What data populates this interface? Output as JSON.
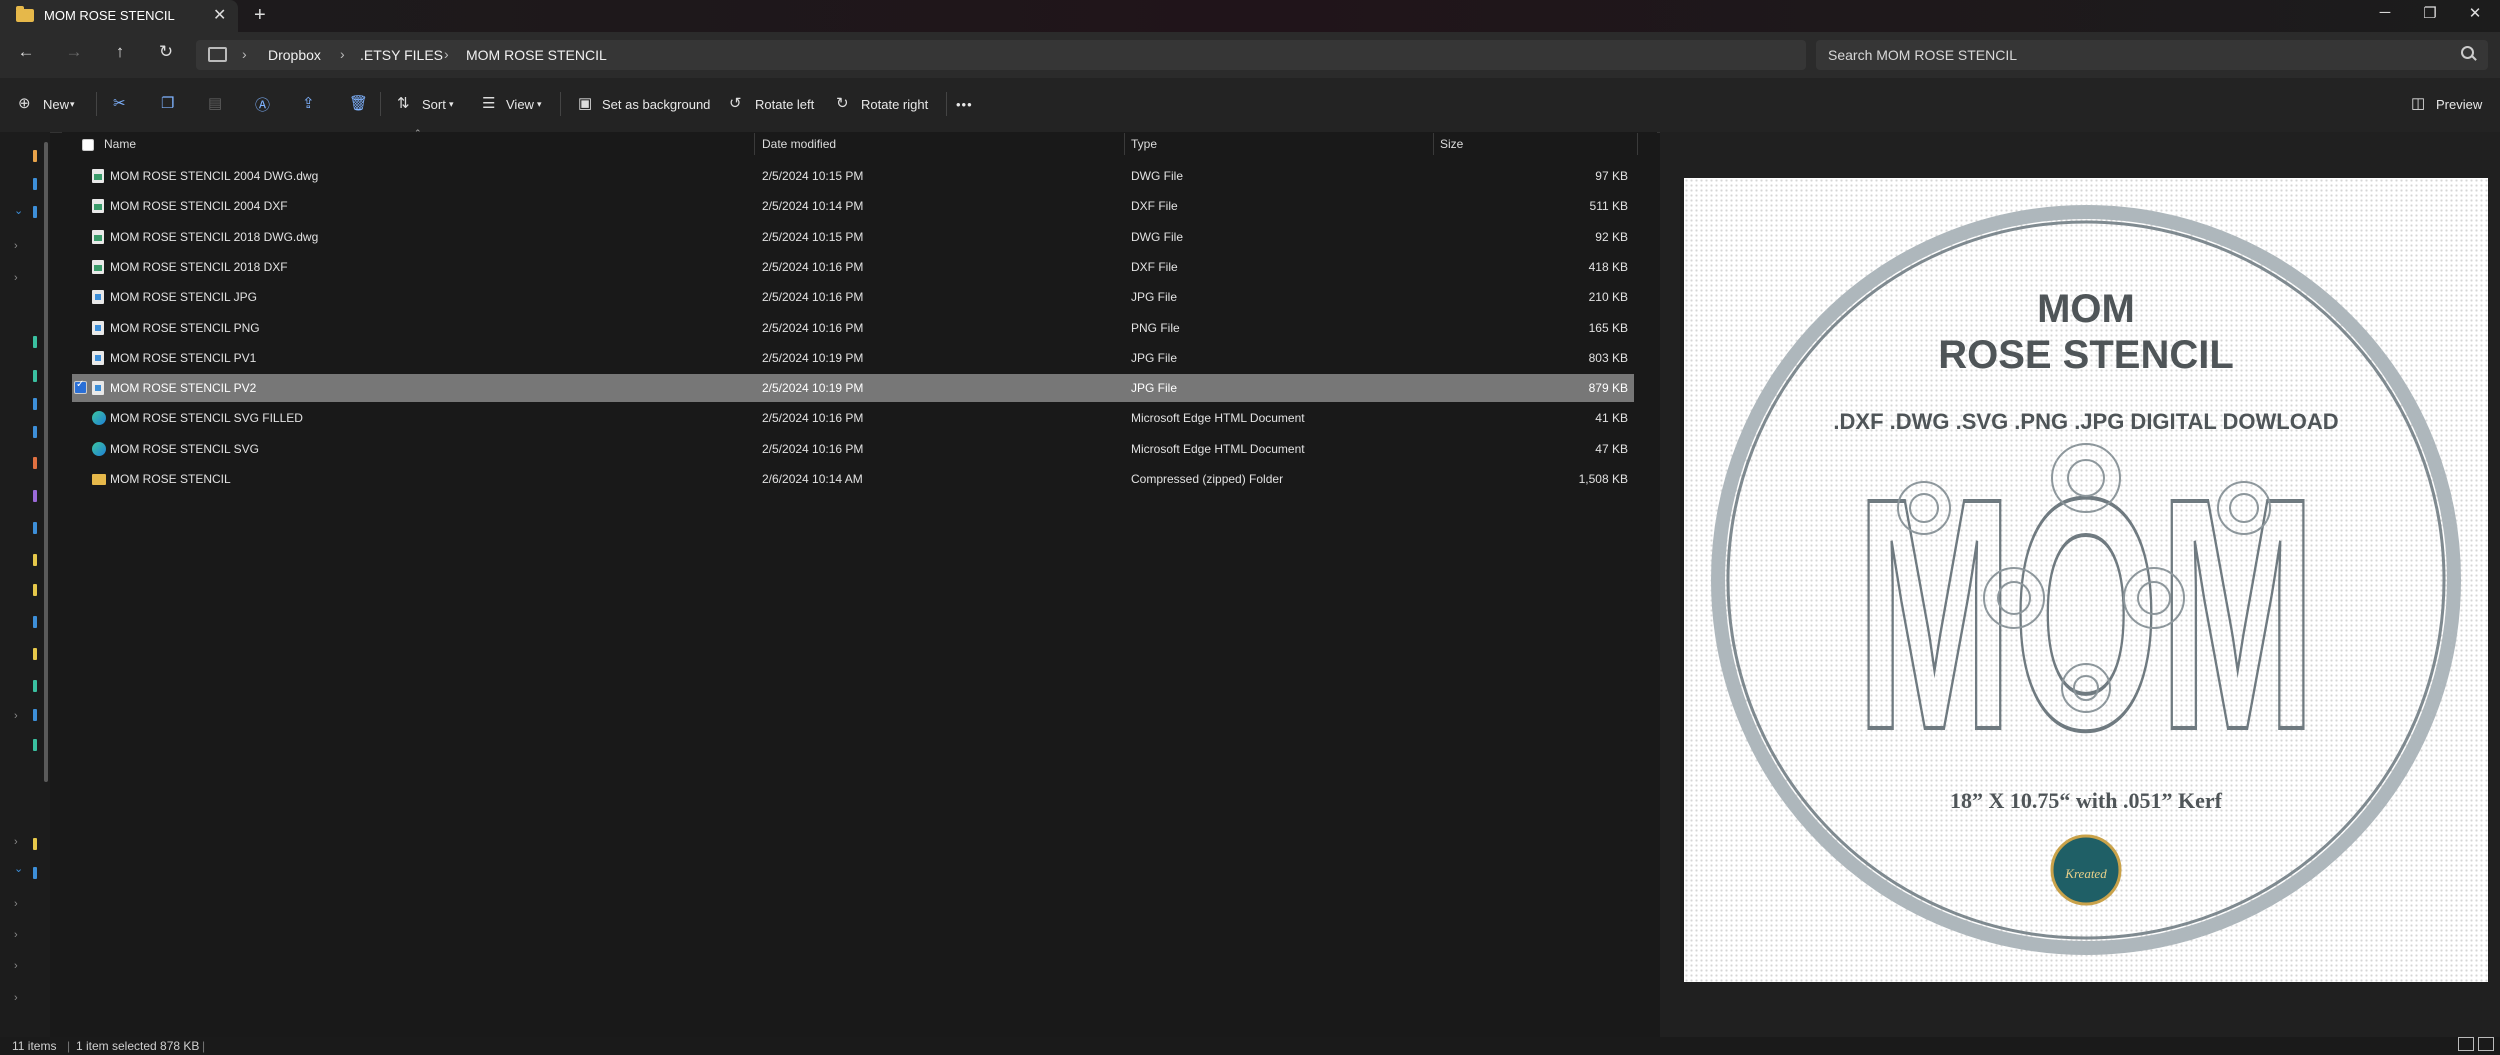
{
  "window": {
    "tab_title": "MOM ROSE STENCIL",
    "new_tab": "+",
    "controls": {
      "minimize": "─",
      "maximize": "❐",
      "close": "✕"
    }
  },
  "address": {
    "breadcrumbs": [
      "Dropbox",
      ".ETSY FILES",
      "MOM ROSE STENCIL"
    ],
    "search_placeholder": "Search MOM ROSE STENCIL"
  },
  "toolbar": {
    "new_label": "New",
    "sort_label": "Sort",
    "view_label": "View",
    "set_background_label": "Set as background",
    "rotate_left_label": "Rotate left",
    "rotate_right_label": "Rotate right",
    "more_label": "•••",
    "preview_label": "Preview"
  },
  "columns": {
    "name": "Name",
    "date": "Date modified",
    "type": "Type",
    "size": "Size"
  },
  "files": [
    {
      "name": "MOM ROSE STENCIL 2004 DWG.dwg",
      "date": "2/5/2024 10:15 PM",
      "type": "DWG File",
      "size": "97 KB",
      "icon": "cad-file-icon",
      "selected": false
    },
    {
      "name": "MOM ROSE STENCIL 2004 DXF",
      "date": "2/5/2024 10:14 PM",
      "type": "DXF File",
      "size": "511 KB",
      "icon": "cad-file-icon",
      "selected": false
    },
    {
      "name": "MOM ROSE STENCIL 2018 DWG.dwg",
      "date": "2/5/2024 10:15 PM",
      "type": "DWG File",
      "size": "92 KB",
      "icon": "cad-file-icon",
      "selected": false
    },
    {
      "name": "MOM ROSE STENCIL 2018 DXF",
      "date": "2/5/2024 10:16 PM",
      "type": "DXF File",
      "size": "418 KB",
      "icon": "cad-file-icon",
      "selected": false
    },
    {
      "name": "MOM ROSE STENCIL JPG",
      "date": "2/5/2024 10:16 PM",
      "type": "JPG File",
      "size": "210 KB",
      "icon": "image-file-icon",
      "selected": false
    },
    {
      "name": "MOM ROSE STENCIL PNG",
      "date": "2/5/2024 10:16 PM",
      "type": "PNG File",
      "size": "165 KB",
      "icon": "image-file-icon",
      "selected": false
    },
    {
      "name": "MOM ROSE STENCIL PV1",
      "date": "2/5/2024 10:19 PM",
      "type": "JPG File",
      "size": "803 KB",
      "icon": "image-file-icon",
      "selected": false
    },
    {
      "name": "MOM ROSE STENCIL PV2",
      "date": "2/5/2024 10:19 PM",
      "type": "JPG File",
      "size": "879 KB",
      "icon": "image-file-icon",
      "selected": true
    },
    {
      "name": "MOM ROSE STENCIL SVG FILLED",
      "date": "2/5/2024 10:16 PM",
      "type": "Microsoft Edge HTML Document",
      "size": "41 KB",
      "icon": "edge-icon",
      "selected": false
    },
    {
      "name": "MOM ROSE STENCIL SVG",
      "date": "2/5/2024 10:16 PM",
      "type": "Microsoft Edge HTML Document",
      "size": "47 KB",
      "icon": "edge-icon",
      "selected": false
    },
    {
      "name": "MOM ROSE STENCIL",
      "date": "2/6/2024 10:14 AM",
      "type": "Compressed (zipped) Folder",
      "size": "1,508 KB",
      "icon": "zip-folder-icon",
      "selected": false
    }
  ],
  "preview": {
    "title_line1": "MOM",
    "title_line2": "ROSE STENCIL",
    "formats": ".DXF .DWG .SVG .PNG .JPG DIGITAL DOWLOAD",
    "big_word": "MOM",
    "dimensions": "18” X 10.75“ with .051” Kerf",
    "logo_text": "Kreated"
  },
  "status": {
    "item_count": "11 items",
    "selection": "1 item selected  878 KB"
  },
  "colors": {
    "selected_row": "#777777",
    "accent": "#7fb3ff",
    "folder": "#e6b84a"
  }
}
